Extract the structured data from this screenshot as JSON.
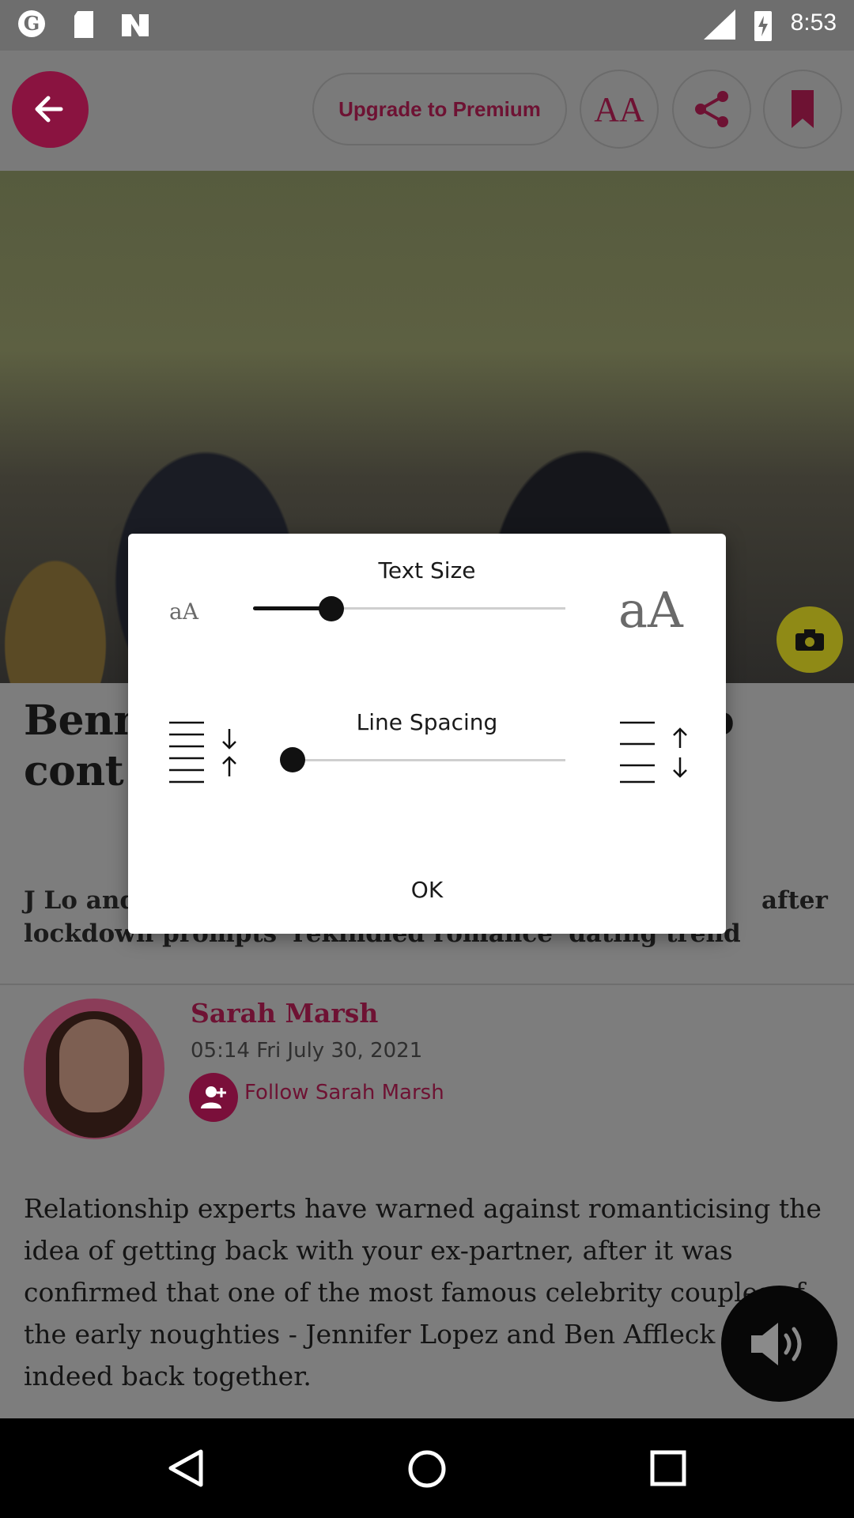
{
  "status_bar": {
    "time": "8:53",
    "network": "LTE"
  },
  "toolbar": {
    "upgrade_label": "Upgrade to Premium",
    "text_size_label": "AA"
  },
  "article": {
    "headline": "Bennifer back: Is getting back with an ex ever a good idea? to contemplate a return to your ex?",
    "headline_visible": "Benn                                          to\ncont",
    "standfirst": "J Lo and Ben Affleck did it, but should you go back to your ex after lockdown prompts 'rekindled romance' dating trend",
    "author_name": "Sarah Marsh",
    "date": "05:14 Fri July 30, 2021",
    "follow_label": "Follow Sarah Marsh",
    "body": "Relationship experts have warned against romanticising the idea of getting back with your ex-partner, after it was confirmed that one of the most famous celebrity couples of the early noughties - Jennifer Lopez and Ben Affleck - are indeed back together."
  },
  "dialog": {
    "text_size_title": "Text Size",
    "text_size_small": "aA",
    "text_size_large": "aA",
    "text_size_value": 0.25,
    "line_spacing_title": "Line Spacing",
    "line_spacing_value": 0.0,
    "ok_label": "OK"
  },
  "colors": {
    "brand": "#8a1340",
    "dialog_bg": "#ffffff",
    "scrim": "#7d7d7d"
  },
  "icons": {
    "back": "arrow-left-icon",
    "share": "share-icon",
    "bookmark": "bookmark-icon",
    "camera": "camera-icon",
    "audio": "volume-icon"
  }
}
